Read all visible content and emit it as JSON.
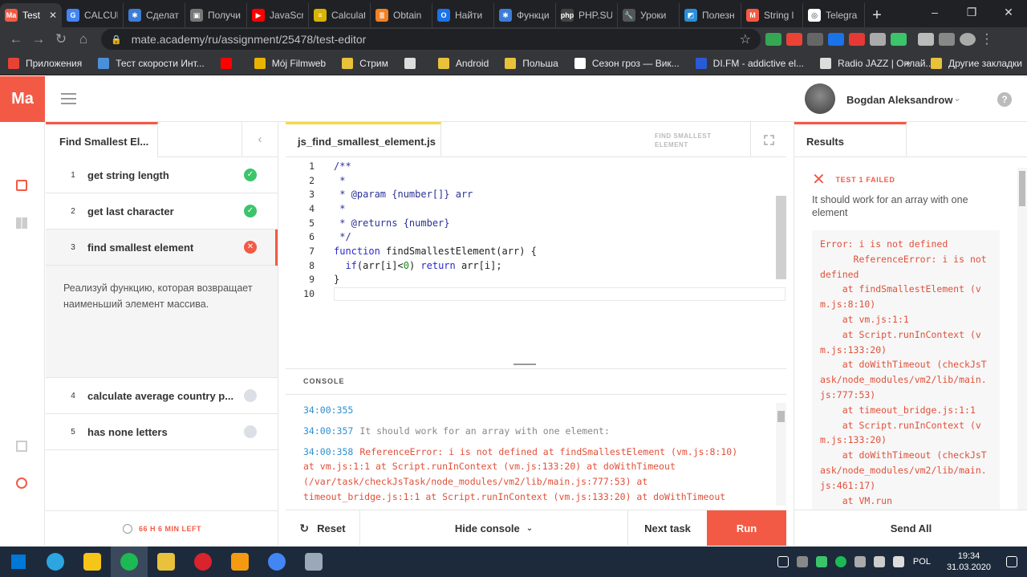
{
  "browser": {
    "tabs": [
      {
        "label": "Test",
        "color": "#f35a45",
        "fav": "Ma",
        "active": true
      },
      {
        "label": "CALCUL",
        "color": "#4285f4",
        "fav": "G"
      },
      {
        "label": "Сделат",
        "color": "#3b7dd8",
        "fav": "✱"
      },
      {
        "label": "Получи",
        "color": "#777",
        "fav": "▣"
      },
      {
        "label": "JavaScr",
        "color": "#ff0000",
        "fav": "▶"
      },
      {
        "label": "Calculat",
        "color": "#d8b400",
        "fav": "≡"
      },
      {
        "label": "Obtain",
        "color": "#f48024",
        "fav": "≣"
      },
      {
        "label": "Найти",
        "color": "#1a73e8",
        "fav": "O"
      },
      {
        "label": "Функци",
        "color": "#3b7dd8",
        "fav": "✱"
      },
      {
        "label": "PHP.SU",
        "color": "#444",
        "fav": "php"
      },
      {
        "label": "Уроки",
        "color": "#555",
        "fav": "🔧"
      },
      {
        "label": "Полезн",
        "color": "#2a8fd8",
        "fav": "◩"
      },
      {
        "label": "String l",
        "color": "#f35a45",
        "fav": "M"
      },
      {
        "label": "Telegra",
        "color": "#fff",
        "fav": "◎"
      }
    ],
    "new_tab": "+",
    "window_controls": {
      "minimize": "–",
      "maximize": "❐",
      "close": "✕"
    },
    "url": "mate.academy/ru/assignment/25478/test-editor",
    "bookmarks": [
      {
        "label": "Приложения",
        "color": "#e94235"
      },
      {
        "label": "Тест скорости Инт...",
        "color": "#4a90d9"
      },
      {
        "label": "",
        "color": "#ff0000"
      },
      {
        "label": "Mój Filmweb",
        "color": "#e8b400"
      },
      {
        "label": "Стрим",
        "color": "#e8c23a"
      },
      {
        "label": "",
        "color": "#ddd"
      },
      {
        "label": "Android",
        "color": "#e8c23a"
      },
      {
        "label": "Польша",
        "color": "#e8c23a"
      },
      {
        "label": "Сезон гроз — Вик...",
        "color": "#fff"
      },
      {
        "label": "DI.FM - addictive el...",
        "color": "#2a5bd7"
      },
      {
        "label": "Radio JAZZ | Онлай...",
        "color": "#ddd"
      }
    ],
    "bookmarks_more": "»",
    "other_bookmarks": "Другие закладки"
  },
  "header": {
    "logo": "Ma",
    "user_name": "Bogdan Aleksandrow",
    "user_chevron": "⌄",
    "help": "?"
  },
  "task_panel": {
    "title": "Find Smallest El...",
    "collapse_icon": "‹",
    "tasks": [
      {
        "num": "1",
        "name": "get string length",
        "status": "done"
      },
      {
        "num": "2",
        "name": "get last character",
        "status": "done"
      },
      {
        "num": "3",
        "name": "find smallest element",
        "status": "failed"
      },
      {
        "num": "4",
        "name": "calculate average country p...",
        "status": "todo"
      },
      {
        "num": "5",
        "name": "has none letters",
        "status": "todo"
      }
    ],
    "description": "Реализуй функцию, которая возвращает наименьший элемент массива.",
    "timer": "66 H 6 MIN LEFT"
  },
  "editor": {
    "file_name": "js_find_smallest_element.js",
    "task_label": "FIND SMALLEST ELEMENT",
    "code_lines": [
      {
        "n": "1",
        "parts": [
          {
            "c": "cmt",
            "t": "/**"
          }
        ]
      },
      {
        "n": "2",
        "parts": [
          {
            "c": "cmt",
            "t": " *"
          }
        ]
      },
      {
        "n": "3",
        "parts": [
          {
            "c": "cmt",
            "t": " * @param {number[]} arr"
          }
        ]
      },
      {
        "n": "4",
        "parts": [
          {
            "c": "cmt",
            "t": " *"
          }
        ]
      },
      {
        "n": "5",
        "parts": [
          {
            "c": "cmt",
            "t": " * @returns {number}"
          }
        ]
      },
      {
        "n": "6",
        "parts": [
          {
            "c": "cmt",
            "t": " */"
          }
        ]
      },
      {
        "n": "7",
        "parts": [
          {
            "c": "kw",
            "t": "function"
          },
          {
            "c": "plain",
            "t": " findSmallestElement(arr) {"
          }
        ]
      },
      {
        "n": "8",
        "parts": [
          {
            "c": "plain",
            "t": "  "
          },
          {
            "c": "kw",
            "t": "if"
          },
          {
            "c": "plain",
            "t": "(arr[i]<"
          },
          {
            "c": "num",
            "t": "0"
          },
          {
            "c": "plain",
            "t": ") "
          },
          {
            "c": "kw",
            "t": "return"
          },
          {
            "c": "plain",
            "t": " arr[i];"
          }
        ]
      },
      {
        "n": "9",
        "parts": [
          {
            "c": "plain",
            "t": "}"
          }
        ]
      },
      {
        "n": "10",
        "parts": [
          {
            "c": "plain",
            "t": ""
          }
        ]
      }
    ],
    "console_label": "CONSOLE",
    "console_entries": [
      {
        "time": "34:00:355",
        "msg": "",
        "err": ""
      },
      {
        "time": "34:00:357",
        "msg": "It should work for an array with one element:",
        "err": ""
      },
      {
        "time": "34:00:358",
        "msg": "",
        "err": "ReferenceError: i is not defined at findSmallestElement (vm.js:8:10) at vm.js:1:1 at Script.runInContext (vm.js:133:20) at doWithTimeout (/var/task/checkJsTask/node_modules/vm2/lib/main.js:777:53) at timeout_bridge.js:1:1 at Script.runInContext (vm.js:133:20) at doWithTimeout"
      }
    ],
    "reset_label": "Reset",
    "hide_console_label": "Hide console",
    "next_task_label": "Next task",
    "run_label": "Run"
  },
  "results": {
    "tab_label": "Results",
    "fail_label": "TEST 1 FAILED",
    "fail_text": "It should work for an array with one element",
    "error_text": "Error: i is not defined\n      ReferenceError: i is not defined\n    at findSmallestElement (vm.js:8:10)\n    at vm.js:1:1\n    at Script.runInContext (vm.js:133:20)\n    at doWithTimeout (checkJsTask/node_modules/vm2/lib/main.js:777:53)\n    at timeout_bridge.js:1:1\n    at Script.runInContext (vm.js:133:20)\n    at doWithTimeout (checkJsTask/node_modules/vm2/lib/main.js:461:17)\n    at VM.run",
    "send_all_label": "Send All"
  },
  "taskbar": {
    "lang": "POL",
    "time": "19:34",
    "date": "31.03.2020",
    "apps": [
      {
        "color": "#0078d7",
        "name": "windows"
      },
      {
        "color": "#2ca5e0",
        "name": "telegram"
      },
      {
        "color": "#f5c518",
        "name": "app"
      },
      {
        "color": "#1db954",
        "name": "spotify"
      },
      {
        "color": "#e8c23a",
        "name": "explorer"
      },
      {
        "color": "#d9232d",
        "name": "opera"
      },
      {
        "color": "#f49a10",
        "name": "sublime"
      },
      {
        "color": "#4285f4",
        "name": "chrome"
      },
      {
        "color": "#9aa8b8",
        "name": "app2"
      }
    ]
  },
  "colors": {
    "accent": "#f35a45",
    "success": "#3cc46b",
    "todo": "#dcdfe6"
  }
}
